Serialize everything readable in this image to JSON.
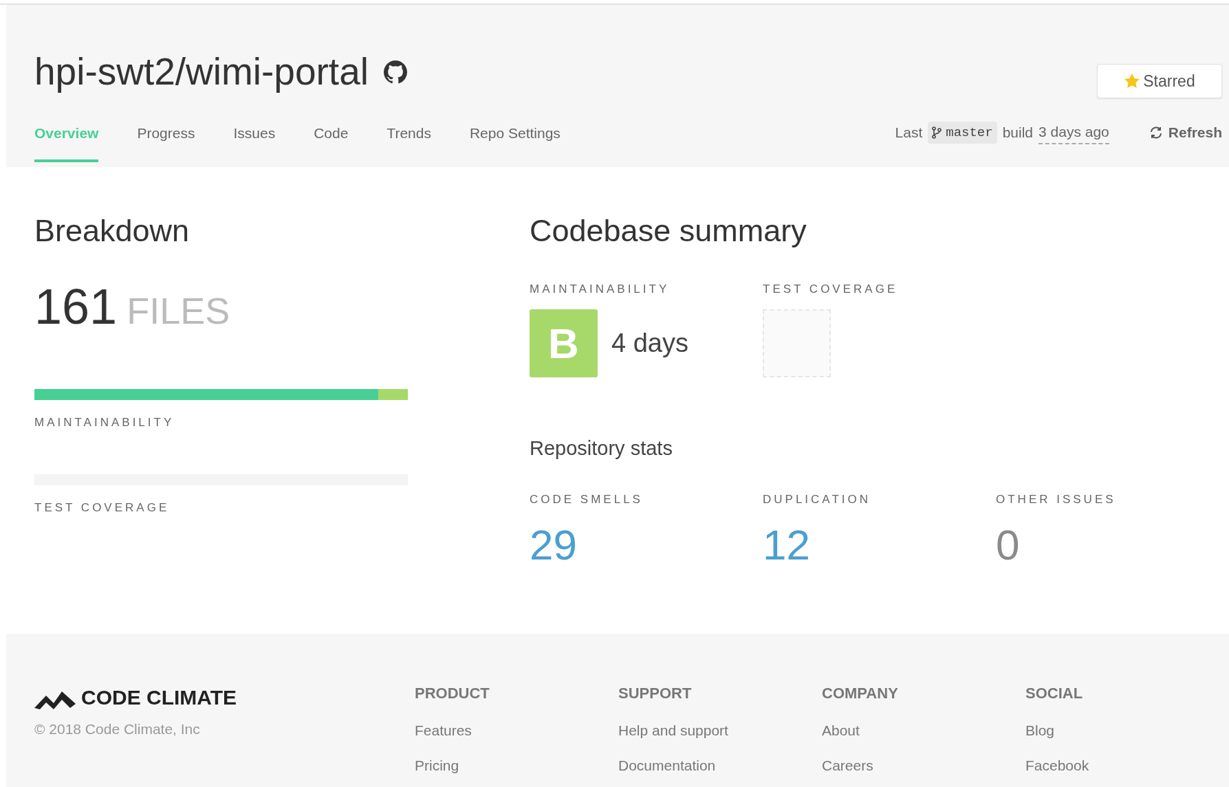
{
  "repo": {
    "title": "hpi-swt2/wimi-portal",
    "star_button": {
      "label": "Starred",
      "starred": true
    }
  },
  "tabs": [
    {
      "label": "Overview",
      "selected": true
    },
    {
      "label": "Progress",
      "selected": false
    },
    {
      "label": "Issues",
      "selected": false
    },
    {
      "label": "Code",
      "selected": false
    },
    {
      "label": "Trends",
      "selected": false
    },
    {
      "label": "Repo Settings",
      "selected": false
    }
  ],
  "build": {
    "prefix": "Last",
    "branch": "master",
    "middle": "build",
    "time": "3 days ago",
    "refresh": "Refresh"
  },
  "breakdown": {
    "title": "Breakdown",
    "count": "161",
    "unit": "FILES",
    "bars": [
      {
        "label": "MAINTAINABILITY",
        "segments": [
          {
            "level": 0.92,
            "color": "#47d094"
          },
          {
            "level": 0.08,
            "color": "#a6d96a"
          }
        ]
      },
      {
        "label": "TEST COVERAGE"
      }
    ]
  },
  "summary": {
    "title": "Codebase summary",
    "maintainability": {
      "label": "MAINTAINABILITY",
      "grade": "B",
      "color": "#a6d96a",
      "debt": "4 days"
    },
    "test_coverage": {
      "label": "TEST COVERAGE"
    },
    "stats_title": "Repository stats",
    "stats": [
      {
        "label": "CODE SMELLS",
        "value": "29",
        "color": "#4a9fd0"
      },
      {
        "label": "DUPLICATION",
        "value": "12",
        "color": "#4a9fd0"
      },
      {
        "label": "OTHER ISSUES",
        "value": "0",
        "color": "#8a8a8a"
      }
    ]
  },
  "footer": {
    "brand": "CODE CLIMATE",
    "copyright": "© 2018 Code Climate, Inc",
    "columns": [
      {
        "heading": "PRODUCT",
        "links": [
          "Features",
          "Pricing"
        ]
      },
      {
        "heading": "SUPPORT",
        "links": [
          "Help and support",
          "Documentation"
        ]
      },
      {
        "heading": "COMPANY",
        "links": [
          "About",
          "Careers"
        ]
      },
      {
        "heading": "SOCIAL",
        "links": [
          "Blog",
          "Facebook"
        ]
      }
    ]
  }
}
